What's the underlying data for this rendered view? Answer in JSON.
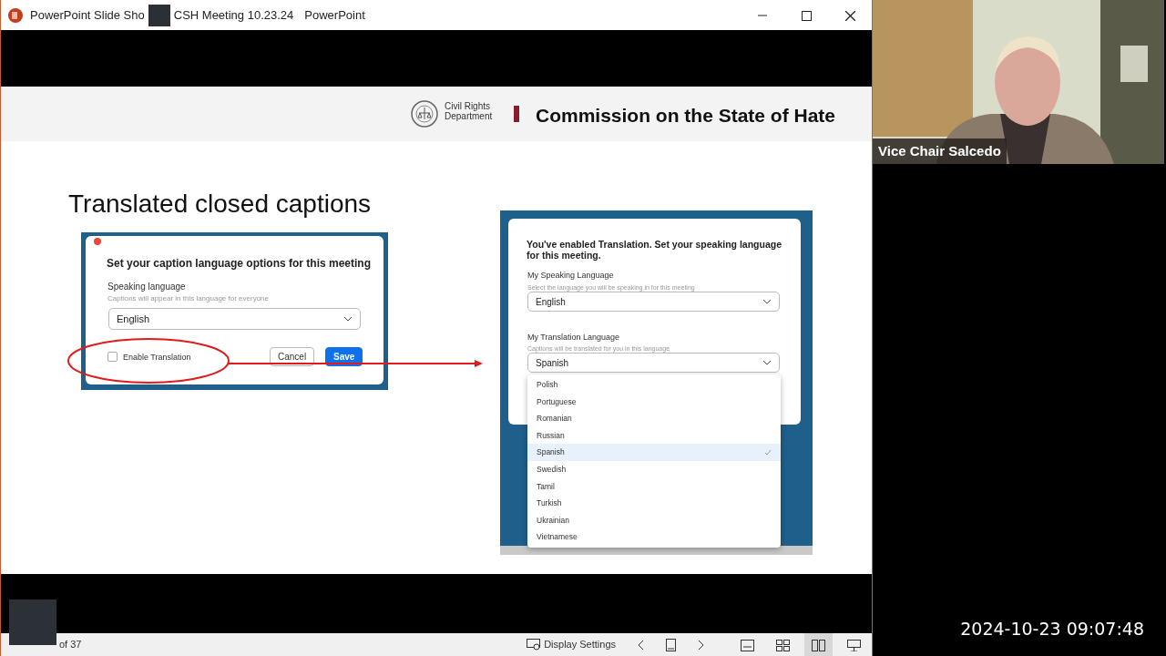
{
  "window": {
    "title_parts": [
      "PowerPoint Slide Sho",
      "CSH Meeting 10.23.24",
      "PowerPoint"
    ]
  },
  "slide": {
    "header": {
      "org_name_lines": [
        "Civil Rights",
        "Department"
      ],
      "title": "Commission on the State of Hate"
    },
    "heading": "Translated closed captions",
    "caption_dialog": {
      "title": "Set your caption language options for this meeting",
      "speaking_label": "Speaking language",
      "hint": "Captions will appear in this language for everyone",
      "value": "English",
      "enable_translation": {
        "label": "Enable Translation",
        "checked": false
      },
      "buttons": [
        {
          "label": "Cancel",
          "kind": "secondary"
        },
        {
          "label": "Save",
          "kind": "primary"
        }
      ]
    },
    "translation_dialog": {
      "title": "You've enabled Translation. Set your speaking language for this meeting.",
      "speaking_label": "My Speaking Language",
      "speaking_hint": "Select the language you will be speaking in for this meeting",
      "speaking_value": "English",
      "translation_label": "My Translation Language",
      "translation_hint": "Captions will be translated for you in this language",
      "translation_value": "Spanish",
      "options": [
        {
          "label": "Polish",
          "selected": false
        },
        {
          "label": "Portuguese",
          "selected": false
        },
        {
          "label": "Romanian",
          "selected": false
        },
        {
          "label": "Russian",
          "selected": false
        },
        {
          "label": "Spanish",
          "selected": true
        },
        {
          "label": "Swedish",
          "selected": false
        },
        {
          "label": "Tamil",
          "selected": false
        },
        {
          "label": "Turkish",
          "selected": false
        },
        {
          "label": "Ukrainian",
          "selected": false
        },
        {
          "label": "Vietnamese",
          "selected": false
        }
      ]
    }
  },
  "status_bar": {
    "slide_counter": "of 37",
    "display_settings": "Display Settings",
    "views": [
      {
        "kind": "normal",
        "selected": false
      },
      {
        "kind": "sorter",
        "selected": false
      },
      {
        "kind": "reading",
        "selected": true
      },
      {
        "kind": "presenter",
        "selected": false
      }
    ]
  },
  "video": {
    "participant_name": "Vice Chair Salcedo"
  },
  "timestamp": "2024-10-23 09:07:48"
}
